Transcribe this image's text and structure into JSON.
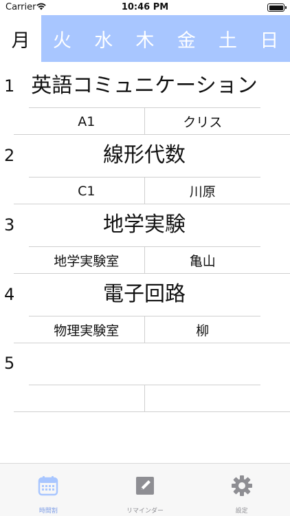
{
  "status_bar": {
    "carrier": "Carrier",
    "time": "10:46 PM"
  },
  "days": [
    "月",
    "火",
    "水",
    "木",
    "金",
    "土",
    "日"
  ],
  "selected_day_index": 0,
  "periods": [
    {
      "number": "1",
      "course": "英語コミュニケーション",
      "room": "A1",
      "teacher": "クリス"
    },
    {
      "number": "2",
      "course": "線形代数",
      "room": "C1",
      "teacher": "川原"
    },
    {
      "number": "3",
      "course": "地学実験",
      "room": "地学実験室",
      "teacher": "亀山"
    },
    {
      "number": "4",
      "course": "電子回路",
      "room": "物理実験室",
      "teacher": "柳"
    },
    {
      "number": "5",
      "course": "",
      "room": "",
      "teacher": ""
    }
  ],
  "tab_bar": {
    "items": [
      {
        "label": "時間割",
        "icon": "calendar-icon",
        "active": true
      },
      {
        "label": "リマインダー",
        "icon": "note-edit-icon",
        "active": false
      },
      {
        "label": "設定",
        "icon": "gear-icon",
        "active": false
      }
    ]
  },
  "colors": {
    "accent": "#a8c6ff",
    "tab_active": "#7f9ee6",
    "tab_inactive": "#8e8e93",
    "divider": "#cfcfcf"
  }
}
